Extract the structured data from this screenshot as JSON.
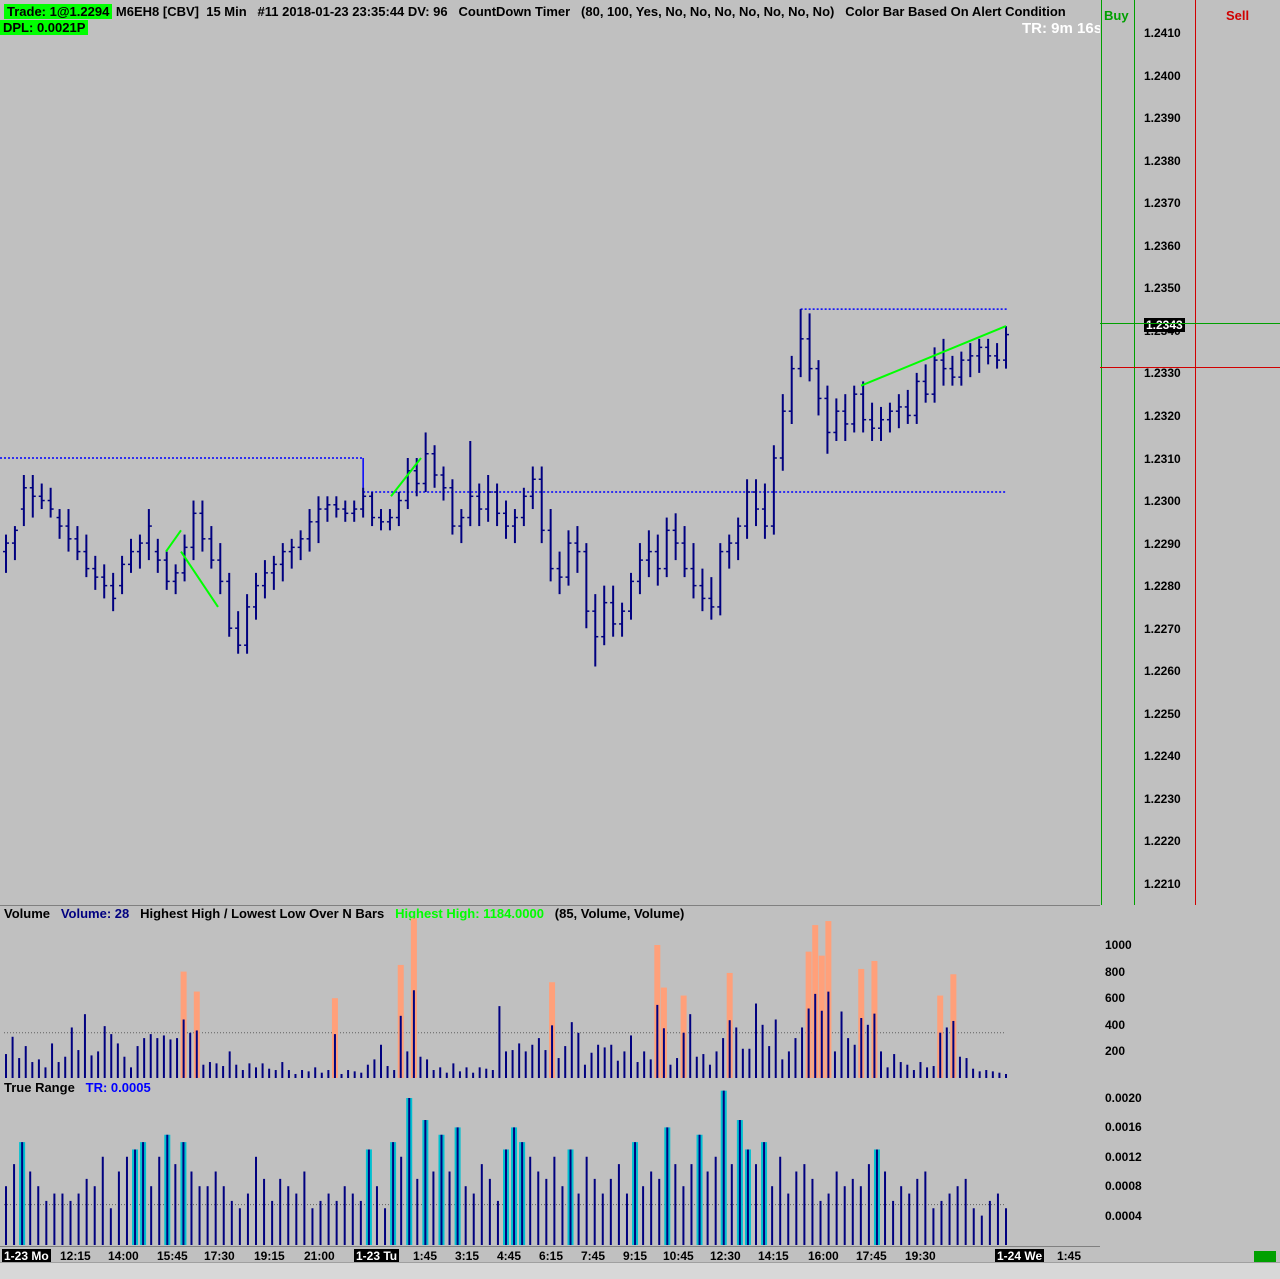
{
  "header": {
    "trade_badge": "Trade: 1@1.2294",
    "symbol": "M6EH8 [CBV]",
    "interval": "15 Min",
    "bar_info": "#11 2018-01-23 23:35:44 DV: 96",
    "indicator": "CountDown Timer",
    "params": "(80, 100, Yes, No, No, No, No, No, No, No)",
    "color_bar": "Color Bar Based On Alert Condition",
    "dpl_badge": "DPL: 0.0021P",
    "timer": "TR: 9m 16s"
  },
  "order_bar": {
    "buy_label": "Buy",
    "sell_label": "Sell",
    "current_price": "1.2343"
  },
  "colors": {
    "background": "#c0c0c0",
    "bar": "#000080",
    "trend": "#00ff00",
    "level": "#0000ff",
    "buy": "#00a000",
    "sell": "#d00000",
    "volume_high": "#ffa07a",
    "tr_high": "#00c0d0"
  },
  "price_axis": [
    "1.2410",
    "1.2400",
    "1.2390",
    "1.2380",
    "1.2370",
    "1.2360",
    "1.2350",
    "1.2340",
    "1.2330",
    "1.2320",
    "1.2310",
    "1.2300",
    "1.2290",
    "1.2280",
    "1.2270",
    "1.2260",
    "1.2250",
    "1.2240",
    "1.2230",
    "1.2220",
    "1.2210"
  ],
  "volume_panel": {
    "name": "Volume",
    "volume": "Volume: 28",
    "study": "Highest High / Lowest Low Over N Bars",
    "highest": "Highest High: 1184.0000",
    "params": "(85, Volume, Volume)",
    "axis": [
      "1000",
      "800",
      "600",
      "400",
      "200"
    ]
  },
  "tr_panel": {
    "name": "True Range",
    "value": "TR: 0.0005",
    "axis": [
      "0.0020",
      "0.0016",
      "0.0012",
      "0.0008",
      "0.0004"
    ]
  },
  "time_axis": [
    "1-23 Mo",
    "12:15",
    "14:00",
    "15:45",
    "17:30",
    "19:15",
    "21:00",
    "1-23 Tu",
    "1:45",
    "3:15",
    "4:45",
    "6:15",
    "7:45",
    "9:15",
    "10:45",
    "12:30",
    "14:15",
    "16:00",
    "17:45",
    "19:30",
    "1-24 We",
    "1:45"
  ],
  "chart_data": {
    "type": "bar",
    "title": "",
    "symbol": "M6EH8",
    "yrange": [
      1.2205,
      1.2415
    ],
    "ohlc_bars": [
      [
        1.229,
        1.2294,
        1.2285,
        1.2292
      ],
      [
        1.2292,
        1.2296,
        1.2288,
        1.2295
      ],
      [
        1.23,
        1.2308,
        1.2296,
        1.2305
      ],
      [
        1.2305,
        1.2308,
        1.2298,
        1.2303
      ],
      [
        1.2303,
        1.2306,
        1.23,
        1.2302
      ],
      [
        1.2302,
        1.2305,
        1.2298,
        1.23
      ],
      [
        1.2298,
        1.23,
        1.2293,
        1.2296
      ],
      [
        1.2296,
        1.23,
        1.229,
        1.2293
      ],
      [
        1.2293,
        1.2296,
        1.2288,
        1.229
      ],
      [
        1.229,
        1.2294,
        1.2284,
        1.2286
      ],
      [
        1.2286,
        1.2289,
        1.2281,
        1.2284
      ],
      [
        1.2284,
        1.2287,
        1.2279,
        1.2282
      ],
      [
        1.2282,
        1.2285,
        1.2276,
        1.2279
      ],
      [
        1.2282,
        1.2289,
        1.228,
        1.2287
      ],
      [
        1.2287,
        1.2293,
        1.2285,
        1.229
      ],
      [
        1.229,
        1.2294,
        1.2286,
        1.2292
      ],
      [
        1.2292,
        1.23,
        1.2288,
        1.2296
      ],
      [
        1.229,
        1.2293,
        1.2285,
        1.2288
      ],
      [
        1.2288,
        1.229,
        1.2281,
        1.2283
      ],
      [
        1.2283,
        1.2287,
        1.228,
        1.2285
      ],
      [
        1.2285,
        1.2294,
        1.2283,
        1.2291
      ],
      [
        1.2291,
        1.2302,
        1.2288,
        1.2299
      ],
      [
        1.2299,
        1.2302,
        1.229,
        1.2293
      ],
      [
        1.2293,
        1.2296,
        1.2286,
        1.2288
      ],
      [
        1.2288,
        1.2292,
        1.228,
        1.2283
      ],
      [
        1.2283,
        1.2285,
        1.227,
        1.2272
      ],
      [
        1.2272,
        1.2276,
        1.2266,
        1.2268
      ],
      [
        1.2268,
        1.228,
        1.2266,
        1.2277
      ],
      [
        1.2277,
        1.2285,
        1.2274,
        1.2282
      ],
      [
        1.2282,
        1.2288,
        1.2279,
        1.2285
      ],
      [
        1.2285,
        1.2289,
        1.2281,
        1.2287
      ],
      [
        1.2287,
        1.2292,
        1.2283,
        1.229
      ],
      [
        1.229,
        1.2293,
        1.2286,
        1.2291
      ],
      [
        1.2291,
        1.2295,
        1.2288,
        1.2293
      ],
      [
        1.2293,
        1.23,
        1.229,
        1.2297
      ],
      [
        1.2297,
        1.2303,
        1.2292,
        1.23
      ],
      [
        1.23,
        1.2303,
        1.2297,
        1.2301
      ],
      [
        1.2301,
        1.2303,
        1.2298,
        1.23
      ],
      [
        1.23,
        1.2302,
        1.2297,
        1.2299
      ],
      [
        1.2299,
        1.2302,
        1.2297,
        1.23
      ],
      [
        1.23,
        1.2305,
        1.2298,
        1.2303
      ],
      [
        1.2303,
        1.2304,
        1.2296,
        1.2298
      ],
      [
        1.2298,
        1.23,
        1.2295,
        1.2297
      ],
      [
        1.2297,
        1.23,
        1.2295,
        1.2298
      ],
      [
        1.2298,
        1.2304,
        1.2296,
        1.2302
      ],
      [
        1.2302,
        1.2312,
        1.23,
        1.2309
      ],
      [
        1.2309,
        1.2312,
        1.2303,
        1.2306
      ],
      [
        1.2306,
        1.2318,
        1.2304,
        1.2313
      ],
      [
        1.2313,
        1.2315,
        1.2305,
        1.2308
      ],
      [
        1.2308,
        1.231,
        1.2302,
        1.2305
      ],
      [
        1.2305,
        1.2307,
        1.2294,
        1.2296
      ],
      [
        1.2296,
        1.23,
        1.2292,
        1.2298
      ],
      [
        1.2298,
        1.2316,
        1.2296,
        1.2303
      ],
      [
        1.2303,
        1.2306,
        1.2296,
        1.23
      ],
      [
        1.23,
        1.2308,
        1.2297,
        1.2304
      ],
      [
        1.2304,
        1.2306,
        1.2296,
        1.2299
      ],
      [
        1.2299,
        1.2302,
        1.2293,
        1.2296
      ],
      [
        1.2296,
        1.23,
        1.2292,
        1.2298
      ],
      [
        1.2298,
        1.2305,
        1.2296,
        1.2303
      ],
      [
        1.2303,
        1.231,
        1.23,
        1.2307
      ],
      [
        1.2307,
        1.231,
        1.2292,
        1.2295
      ],
      [
        1.2295,
        1.23,
        1.2283,
        1.2286
      ],
      [
        1.2286,
        1.229,
        1.228,
        1.2284
      ],
      [
        1.2284,
        1.2295,
        1.2282,
        1.2292
      ],
      [
        1.2292,
        1.2296,
        1.2285,
        1.229
      ],
      [
        1.229,
        1.2292,
        1.2272,
        1.2276
      ],
      [
        1.2276,
        1.228,
        1.2263,
        1.227
      ],
      [
        1.227,
        1.2282,
        1.2268,
        1.2278
      ],
      [
        1.2278,
        1.2282,
        1.227,
        1.2273
      ],
      [
        1.2273,
        1.2278,
        1.227,
        1.2276
      ],
      [
        1.2276,
        1.2285,
        1.2274,
        1.2283
      ],
      [
        1.2283,
        1.2292,
        1.228,
        1.2288
      ],
      [
        1.2288,
        1.2295,
        1.2284,
        1.229
      ],
      [
        1.229,
        1.2294,
        1.2282,
        1.2286
      ],
      [
        1.2286,
        1.2298,
        1.2284,
        1.2295
      ],
      [
        1.2295,
        1.2299,
        1.2288,
        1.2292
      ],
      [
        1.2292,
        1.2296,
        1.2284,
        1.2286
      ],
      [
        1.2286,
        1.2292,
        1.2279,
        1.2282
      ],
      [
        1.2282,
        1.2286,
        1.2276,
        1.2279
      ],
      [
        1.2279,
        1.2284,
        1.2274,
        1.2277
      ],
      [
        1.2277,
        1.2292,
        1.2275,
        1.229
      ],
      [
        1.229,
        1.2294,
        1.2286,
        1.2292
      ],
      [
        1.2292,
        1.2298,
        1.2288,
        1.2296
      ],
      [
        1.2296,
        1.2307,
        1.2293,
        1.2304
      ],
      [
        1.2304,
        1.2307,
        1.2296,
        1.23
      ],
      [
        1.23,
        1.2306,
        1.2293,
        1.2296
      ],
      [
        1.2296,
        1.2315,
        1.2294,
        1.2312
      ],
      [
        1.2312,
        1.2327,
        1.2309,
        1.2323
      ],
      [
        1.2323,
        1.2336,
        1.232,
        1.2333
      ],
      [
        1.2333,
        1.2347,
        1.2331,
        1.234
      ],
      [
        1.234,
        1.2346,
        1.233,
        1.2333
      ],
      [
        1.2333,
        1.2335,
        1.2322,
        1.2326
      ],
      [
        1.2326,
        1.2329,
        1.2313,
        1.2318
      ],
      [
        1.2318,
        1.2326,
        1.2316,
        1.2323
      ],
      [
        1.2323,
        1.2327,
        1.2316,
        1.232
      ],
      [
        1.232,
        1.2329,
        1.2318,
        1.2327
      ],
      [
        1.2327,
        1.233,
        1.2318,
        1.2321
      ],
      [
        1.2321,
        1.2325,
        1.2316,
        1.2319
      ],
      [
        1.2319,
        1.2324,
        1.2316,
        1.2321
      ],
      [
        1.2321,
        1.2325,
        1.2318,
        1.2323
      ],
      [
        1.2323,
        1.2327,
        1.2319,
        1.2324
      ],
      [
        1.2324,
        1.2328,
        1.232,
        1.2322
      ],
      [
        1.2322,
        1.2332,
        1.232,
        1.233
      ],
      [
        1.233,
        1.2334,
        1.2325,
        1.2327
      ],
      [
        1.2327,
        1.2338,
        1.2325,
        1.2335
      ],
      [
        1.2335,
        1.234,
        1.2329,
        1.2333
      ],
      [
        1.2333,
        1.2336,
        1.2329,
        1.2331
      ],
      [
        1.2331,
        1.2337,
        1.2329,
        1.2335
      ],
      [
        1.2335,
        1.2339,
        1.2331,
        1.2336
      ],
      [
        1.2336,
        1.234,
        1.2332,
        1.2338
      ],
      [
        1.2338,
        1.234,
        1.2334,
        1.2336
      ],
      [
        1.2336,
        1.2339,
        1.2333,
        1.2335
      ],
      [
        1.2335,
        1.2343,
        1.2333,
        1.2341
      ]
    ],
    "high_level": 1.2347,
    "low_level": 1.2304,
    "left_level": 1.2312,
    "volume_values": [
      180,
      310,
      150,
      240,
      120,
      140,
      80,
      260,
      120,
      160,
      380,
      210,
      480,
      170,
      200,
      390,
      330,
      260,
      160,
      80,
      240,
      300,
      330,
      300,
      320,
      290,
      300,
      800,
      340,
      650,
      100,
      120,
      110,
      90,
      200,
      100,
      60,
      110,
      80,
      110,
      70,
      60,
      120,
      60,
      30,
      60,
      50,
      80,
      40,
      60,
      600,
      30,
      60,
      50,
      40,
      100,
      140,
      250,
      90,
      60,
      850,
      200,
      1200,
      160,
      140,
      60,
      80,
      40,
      110,
      50,
      80,
      40,
      80,
      70,
      60,
      540,
      200,
      210,
      260,
      200,
      250,
      300,
      210,
      720,
      150,
      240,
      420,
      340,
      100,
      190,
      250,
      230,
      250,
      130,
      200,
      320,
      120,
      200,
      140,
      1000,
      680,
      100,
      150,
      620,
      480,
      160,
      180,
      100,
      200,
      300,
      790,
      380,
      220,
      220,
      560,
      400,
      240,
      440,
      140,
      200,
      300,
      380,
      950,
      1150,
      920,
      1180,
      200,
      500,
      300,
      250,
      820,
      400,
      880,
      200,
      80,
      180,
      120,
      100,
      60,
      120,
      80,
      90,
      620,
      380,
      780,
      160,
      150,
      70,
      50,
      60,
      50,
      40,
      30
    ],
    "tr_values": [
      8,
      11,
      14,
      10,
      8,
      6,
      7,
      7,
      6,
      7,
      9,
      8,
      12,
      5,
      10,
      12,
      13,
      14,
      8,
      12,
      15,
      11,
      14,
      10,
      8,
      8,
      10,
      8,
      6,
      5,
      7,
      12,
      9,
      6,
      9,
      8,
      7,
      10,
      5,
      6,
      7,
      6,
      8,
      7,
      6,
      13,
      8,
      5,
      14,
      12,
      20,
      9,
      17,
      10,
      15,
      10,
      16,
      8,
      7,
      11,
      9,
      6,
      13,
      16,
      14,
      12,
      10,
      9,
      12,
      8,
      13,
      7,
      12,
      9,
      7,
      9,
      11,
      7,
      14,
      8,
      10,
      9,
      16,
      11,
      8,
      11,
      15,
      10,
      12,
      21,
      11,
      17,
      13,
      11,
      14,
      8,
      12,
      7,
      10,
      11,
      9,
      6,
      7,
      10,
      8,
      9,
      8,
      11,
      13,
      10,
      6,
      8,
      7,
      9,
      10,
      5,
      6,
      7,
      8,
      9,
      5,
      4,
      6,
      7,
      5
    ]
  }
}
